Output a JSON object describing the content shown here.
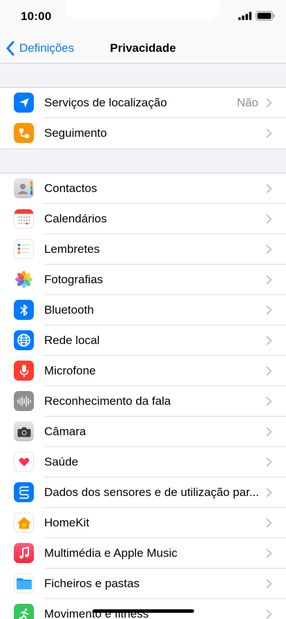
{
  "status_bar": {
    "time": "10:00"
  },
  "nav": {
    "back_label": "Definições",
    "title": "Privacidade"
  },
  "group1": [
    {
      "label": "Serviços de localização",
      "detail": "Não",
      "icon": "location-arrow-icon",
      "color": "#007aff"
    },
    {
      "label": "Seguimento",
      "detail": "",
      "icon": "tracking-icon",
      "color": "#ff9500"
    }
  ],
  "group2": [
    {
      "label": "Contactos",
      "icon": "contacts-icon",
      "color": "#d4d4d8"
    },
    {
      "label": "Calendários",
      "icon": "calendar-icon",
      "color": "#ffffff"
    },
    {
      "label": "Lembretes",
      "icon": "reminders-icon",
      "color": "#ffffff"
    },
    {
      "label": "Fotografias",
      "icon": "photos-icon",
      "color": "#ffffff"
    },
    {
      "label": "Bluetooth",
      "icon": "bluetooth-icon",
      "color": "#007aff"
    },
    {
      "label": "Rede local",
      "icon": "globe-icon",
      "color": "#007aff"
    },
    {
      "label": "Microfone",
      "icon": "microphone-icon",
      "color": "#ff3b30"
    },
    {
      "label": "Reconhecimento da fala",
      "icon": "waveform-icon",
      "color": "#8e8e93"
    },
    {
      "label": "Câmara",
      "icon": "camera-icon",
      "color": "#d1d1d6"
    },
    {
      "label": "Saúde",
      "icon": "heart-icon",
      "color": "#ffffff"
    },
    {
      "label": "Dados dos sensores e de utilização par...",
      "icon": "sensor-data-icon",
      "color": "#007aff"
    },
    {
      "label": "HomeKit",
      "icon": "home-icon",
      "color": "#ffffff"
    },
    {
      "label": "Multimédia e Apple Music",
      "icon": "music-note-icon",
      "color": "#fc3c5b"
    },
    {
      "label": "Ficheiros e pastas",
      "icon": "folder-icon",
      "color": "#ffffff"
    },
    {
      "label": "Movimento e fitness",
      "icon": "fitness-runner-icon",
      "color": "#34c759"
    }
  ]
}
